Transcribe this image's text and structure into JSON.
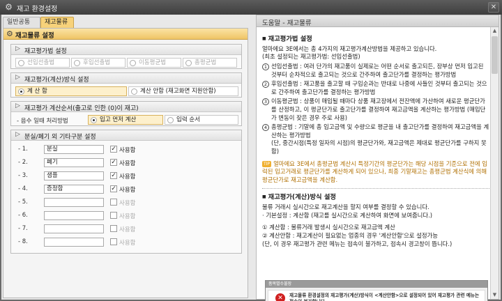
{
  "window": {
    "title": "재고 환경설정",
    "close_glyph": "✕",
    "icon": "gear-icon"
  },
  "tabs": [
    {
      "label": "일반공통",
      "active": false
    },
    {
      "label": "재고물류",
      "active": true
    }
  ],
  "left": {
    "panel_title": "재고물류 설정",
    "valuation_method": {
      "title": "재고평가법 설정",
      "options": [
        "선입선출법",
        "후입선출법",
        "이동평균법",
        "총평균법"
      ],
      "enabled": false
    },
    "valuation_timing": {
      "title": "재고평가(계산)방식 설정",
      "options": [
        "계 산 함",
        "계산 안함 (재고화면 지원안함)"
      ],
      "selected_index": 0
    },
    "calc_order": {
      "title": "재고평가 계산순서(출고로 인한 (0)이 재고)",
      "row_label": "- 음수 일때 처리방법",
      "options": [
        "입고 먼저 계산",
        "입력 순서"
      ],
      "selected_index": 0
    },
    "categories": {
      "title": "분실/폐기 외 기타구분 설정",
      "check_label": "사용함",
      "rows": [
        {
          "no": "- 1.",
          "name": "분실",
          "used": true
        },
        {
          "no": "- 2.",
          "name": "폐기",
          "used": true
        },
        {
          "no": "- 3.",
          "name": "샘플",
          "used": true
        },
        {
          "no": "- 4.",
          "name": "증정함",
          "used": true
        },
        {
          "no": "- 5.",
          "name": "",
          "used": false
        },
        {
          "no": "- 6.",
          "name": "",
          "used": false
        },
        {
          "no": "- 7.",
          "name": "",
          "used": false
        },
        {
          "no": "- 8.",
          "name": "",
          "used": false
        }
      ]
    }
  },
  "help": {
    "title": "도움말 - 재고물류",
    "sec1_title": "재고평가법 설정",
    "sec1_intro1": "얼마에요 3E에서는 총 4가지의 재고평가계산방법을 제공하고 있습니다.",
    "sec1_intro2": "(최초 설정되는 재고평가법: 선입선출법)",
    "items": [
      {
        "n": "1",
        "text": "선입선출법 : 여러 단가의 재고품이 실제로는 어떤 순서로 출고되든, 장부상 먼저 입고된 것부터 순차적으로 출고되는 것으로 간주하여 출고단가를 결정하는 평가방법"
      },
      {
        "n": "2",
        "text": "후입선출법 : 재고품을 출고할 때 구입순과는 반대로 나중에 사들인 것부터 출고되는 것으로 간주하여 출고단가를 결정하는 평가방법"
      },
      {
        "n": "3",
        "text": "이동평균법 : 상품이 매입될 때마다 상품 재고장에서 전잔액에 가산하여 새로운 평균단가를 산정하고, 이 평균단가로 출고단가를 결정하여 재고금액을 계산하는 평가방법 (매입단가 변동이 잦은 경우 주로 사용)"
      },
      {
        "n": "4",
        "text": "총평균법 : 기말에 총 입고금액 및 수량으로 평균을 내 출고단가를 결정하여 재고금액을 계산하는 평가방법"
      }
    ],
    "item4_extra": "(단, 중간시점(특정 일자의 시점)의 평균단가와, 재고금액은 제대로 평균단가를 구하지 못함)",
    "tip_badge": "TIP",
    "tip": "얼마에요 3E에서 총평균법 계산시 특정기간의 평균단가는 해당 시점을 기준으로 전에 입력된 입고거래로 평균단가를 계산하게 되어 있으나, 최종 기말재고는 총평균법 계산식에 의해 평균단가로 재고금액을 계산함.",
    "sec2_title": "재고평가(계산)방식 설정",
    "sec2_l1": "물류 거래시 실시간으로 재고계산을 할지 여부를 결정할 수 있습니다.",
    "sec2_l2": "· 기본설정 : 계산함 (재고를 실시간으로 계산하여 화면에 보여줍니다.)",
    "sec2_i1": "① 계산함 : 물류거래 발생시 실시간으로 재고금액 계산",
    "sec2_i2": "② 계산안함 : 재고계산이 필요없는 업종의 경우 '계산안함'으로 설정가능",
    "sec2_i3": "(단, 이 경우 재고평가 관련 메뉴는 접속이 불가하고, 접속시 경고창이 뜹니다.)",
    "msg_title": "품목별수불장",
    "msg_icon": "error-icon",
    "msg_text": "재고물류 환경설정의 재고평가(계산)방식이 <계산안함>으로 설정되어 있어 재고평가 관련 메뉴는 접속이 불가합니다."
  }
}
